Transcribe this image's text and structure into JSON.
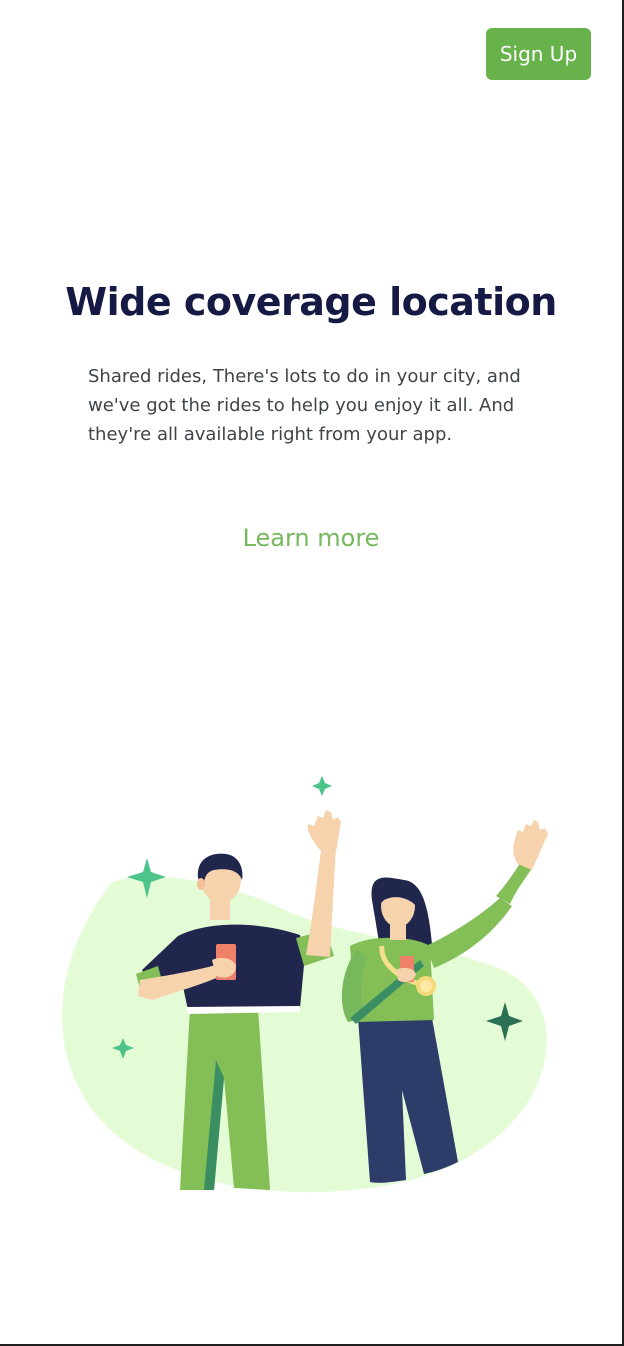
{
  "header": {
    "signup_label": "Sign Up"
  },
  "content": {
    "title": "Wide coverage location",
    "description": "Shared rides, There's lots to do in your city, and we've got the rides to help you enjoy it all. And they're all available right from your app.",
    "learn_more_label": "Learn more"
  },
  "illustration": {
    "name": "people-waving-illustration"
  },
  "colors": {
    "accent": "#67b24a",
    "title": "#151943",
    "text": "#3f4447",
    "link": "#76b85b",
    "blob": "#e3fcd6"
  }
}
